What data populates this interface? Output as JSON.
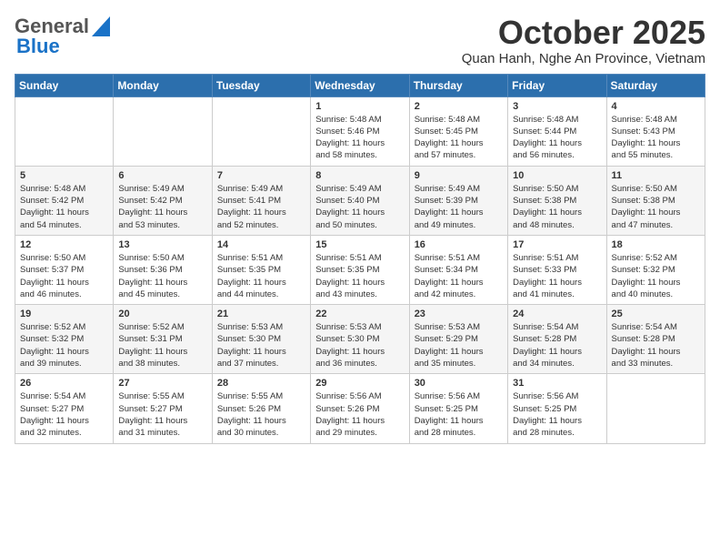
{
  "header": {
    "logo_general": "General",
    "logo_blue": "Blue",
    "month_title": "October 2025",
    "location": "Quan Hanh, Nghe An Province, Vietnam"
  },
  "calendar": {
    "headers": [
      "Sunday",
      "Monday",
      "Tuesday",
      "Wednesday",
      "Thursday",
      "Friday",
      "Saturday"
    ],
    "rows": [
      [
        {
          "day": "",
          "info": ""
        },
        {
          "day": "",
          "info": ""
        },
        {
          "day": "",
          "info": ""
        },
        {
          "day": "1",
          "info": "Sunrise: 5:48 AM\nSunset: 5:46 PM\nDaylight: 11 hours\nand 58 minutes."
        },
        {
          "day": "2",
          "info": "Sunrise: 5:48 AM\nSunset: 5:45 PM\nDaylight: 11 hours\nand 57 minutes."
        },
        {
          "day": "3",
          "info": "Sunrise: 5:48 AM\nSunset: 5:44 PM\nDaylight: 11 hours\nand 56 minutes."
        },
        {
          "day": "4",
          "info": "Sunrise: 5:48 AM\nSunset: 5:43 PM\nDaylight: 11 hours\nand 55 minutes."
        }
      ],
      [
        {
          "day": "5",
          "info": "Sunrise: 5:48 AM\nSunset: 5:42 PM\nDaylight: 11 hours\nand 54 minutes."
        },
        {
          "day": "6",
          "info": "Sunrise: 5:49 AM\nSunset: 5:42 PM\nDaylight: 11 hours\nand 53 minutes."
        },
        {
          "day": "7",
          "info": "Sunrise: 5:49 AM\nSunset: 5:41 PM\nDaylight: 11 hours\nand 52 minutes."
        },
        {
          "day": "8",
          "info": "Sunrise: 5:49 AM\nSunset: 5:40 PM\nDaylight: 11 hours\nand 50 minutes."
        },
        {
          "day": "9",
          "info": "Sunrise: 5:49 AM\nSunset: 5:39 PM\nDaylight: 11 hours\nand 49 minutes."
        },
        {
          "day": "10",
          "info": "Sunrise: 5:50 AM\nSunset: 5:38 PM\nDaylight: 11 hours\nand 48 minutes."
        },
        {
          "day": "11",
          "info": "Sunrise: 5:50 AM\nSunset: 5:38 PM\nDaylight: 11 hours\nand 47 minutes."
        }
      ],
      [
        {
          "day": "12",
          "info": "Sunrise: 5:50 AM\nSunset: 5:37 PM\nDaylight: 11 hours\nand 46 minutes."
        },
        {
          "day": "13",
          "info": "Sunrise: 5:50 AM\nSunset: 5:36 PM\nDaylight: 11 hours\nand 45 minutes."
        },
        {
          "day": "14",
          "info": "Sunrise: 5:51 AM\nSunset: 5:35 PM\nDaylight: 11 hours\nand 44 minutes."
        },
        {
          "day": "15",
          "info": "Sunrise: 5:51 AM\nSunset: 5:35 PM\nDaylight: 11 hours\nand 43 minutes."
        },
        {
          "day": "16",
          "info": "Sunrise: 5:51 AM\nSunset: 5:34 PM\nDaylight: 11 hours\nand 42 minutes."
        },
        {
          "day": "17",
          "info": "Sunrise: 5:51 AM\nSunset: 5:33 PM\nDaylight: 11 hours\nand 41 minutes."
        },
        {
          "day": "18",
          "info": "Sunrise: 5:52 AM\nSunset: 5:32 PM\nDaylight: 11 hours\nand 40 minutes."
        }
      ],
      [
        {
          "day": "19",
          "info": "Sunrise: 5:52 AM\nSunset: 5:32 PM\nDaylight: 11 hours\nand 39 minutes."
        },
        {
          "day": "20",
          "info": "Sunrise: 5:52 AM\nSunset: 5:31 PM\nDaylight: 11 hours\nand 38 minutes."
        },
        {
          "day": "21",
          "info": "Sunrise: 5:53 AM\nSunset: 5:30 PM\nDaylight: 11 hours\nand 37 minutes."
        },
        {
          "day": "22",
          "info": "Sunrise: 5:53 AM\nSunset: 5:30 PM\nDaylight: 11 hours\nand 36 minutes."
        },
        {
          "day": "23",
          "info": "Sunrise: 5:53 AM\nSunset: 5:29 PM\nDaylight: 11 hours\nand 35 minutes."
        },
        {
          "day": "24",
          "info": "Sunrise: 5:54 AM\nSunset: 5:28 PM\nDaylight: 11 hours\nand 34 minutes."
        },
        {
          "day": "25",
          "info": "Sunrise: 5:54 AM\nSunset: 5:28 PM\nDaylight: 11 hours\nand 33 minutes."
        }
      ],
      [
        {
          "day": "26",
          "info": "Sunrise: 5:54 AM\nSunset: 5:27 PM\nDaylight: 11 hours\nand 32 minutes."
        },
        {
          "day": "27",
          "info": "Sunrise: 5:55 AM\nSunset: 5:27 PM\nDaylight: 11 hours\nand 31 minutes."
        },
        {
          "day": "28",
          "info": "Sunrise: 5:55 AM\nSunset: 5:26 PM\nDaylight: 11 hours\nand 30 minutes."
        },
        {
          "day": "29",
          "info": "Sunrise: 5:56 AM\nSunset: 5:26 PM\nDaylight: 11 hours\nand 29 minutes."
        },
        {
          "day": "30",
          "info": "Sunrise: 5:56 AM\nSunset: 5:25 PM\nDaylight: 11 hours\nand 28 minutes."
        },
        {
          "day": "31",
          "info": "Sunrise: 5:56 AM\nSunset: 5:25 PM\nDaylight: 11 hours\nand 28 minutes."
        },
        {
          "day": "",
          "info": ""
        }
      ]
    ]
  }
}
